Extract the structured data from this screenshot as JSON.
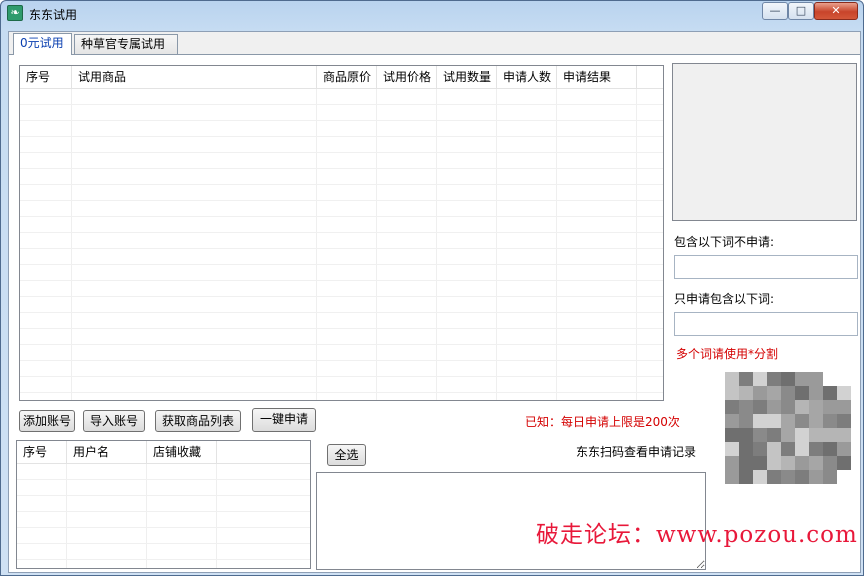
{
  "window": {
    "title": "东东试用",
    "min_glyph": "—",
    "max_glyph": "□",
    "close_glyph": "✕"
  },
  "tabs": [
    {
      "label": "0元试用",
      "active": true
    },
    {
      "label": "种草官专属试用",
      "active": false
    }
  ],
  "product_grid": {
    "columns": [
      "序号",
      "试用商品",
      "商品原价",
      "试用价格",
      "试用数量",
      "申请人数",
      "申请结果"
    ],
    "rows": []
  },
  "filters": {
    "exclude_label": "包含以下词不申请:",
    "exclude_value": "",
    "include_label": "只申请包含以下词:",
    "include_value": "",
    "hint": "多个词请使用*分割"
  },
  "actions": {
    "add_account": "添加账号",
    "import_account": "导入账号",
    "fetch_list": "获取商品列表",
    "one_click": "一键申请",
    "limit_notice": "已知：每日申请上限是200次"
  },
  "account_grid": {
    "columns": [
      "序号",
      "用户名",
      "店铺收藏"
    ],
    "rows": []
  },
  "log": {
    "select_all": "全选",
    "scan_label": "东东扫码查看申请记录",
    "content": ""
  },
  "watermark": "破走论坛：www.pozou.com",
  "colors": {
    "accent_red": "#d40000",
    "active_tab_text": "#0a3fb0",
    "watermark": "#e8183a"
  },
  "icons": {
    "app": "app-logo-icon",
    "qr": "qr-code-icon"
  }
}
